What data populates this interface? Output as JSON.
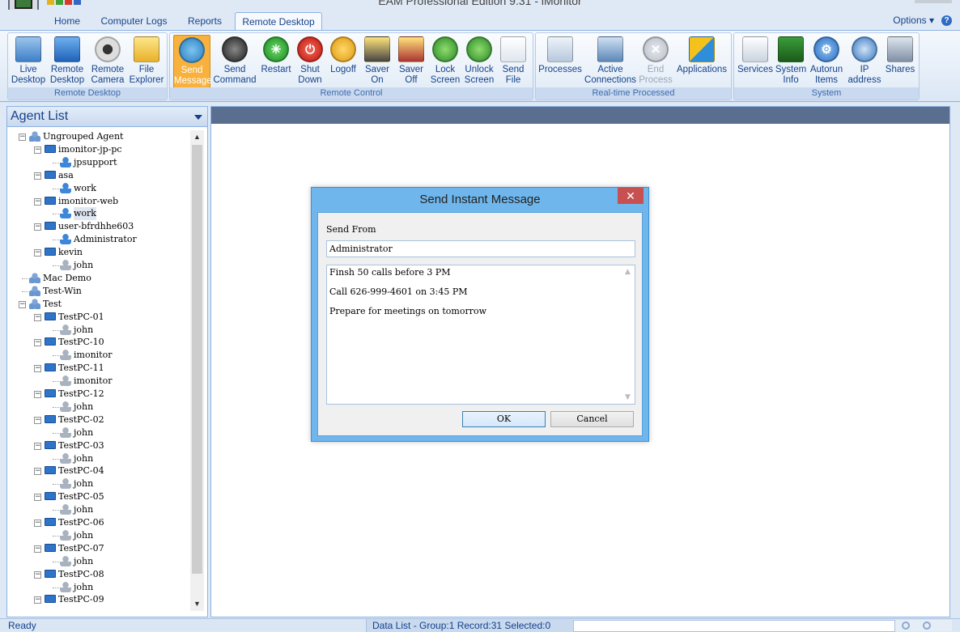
{
  "window": {
    "title": "EAM Professional Edition 9.31 - iMonitor"
  },
  "tabs": [
    {
      "label": "Home"
    },
    {
      "label": "Computer Logs"
    },
    {
      "label": "Reports"
    },
    {
      "label": "Remote Desktop",
      "active": true
    }
  ],
  "options_label": "Options",
  "ribbon": {
    "groups": [
      {
        "label": "Remote Desktop",
        "buttons": [
          {
            "label": "Live Desktop",
            "icon": "monitor-icon"
          },
          {
            "label": "Remote Desktop",
            "icon": "desktop-icon"
          },
          {
            "label": "Remote Camera",
            "icon": "webcam-icon"
          },
          {
            "label": "File Explorer",
            "icon": "folder-icon"
          }
        ]
      },
      {
        "label": "Remote Control",
        "buttons": [
          {
            "label": "Send Message",
            "icon": "message-icon",
            "active": true
          },
          {
            "label": "Send Command",
            "icon": "command-icon"
          },
          {
            "label": "Restart",
            "icon": "restart-icon"
          },
          {
            "label": "Shut Down",
            "icon": "power-icon"
          },
          {
            "label": "Logoff",
            "icon": "key-icon"
          },
          {
            "label": "Saver On",
            "icon": "screensaver-on-icon"
          },
          {
            "label": "Saver Off",
            "icon": "screensaver-off-icon"
          },
          {
            "label": "Lock Screen",
            "icon": "lock-screen-icon"
          },
          {
            "label": "Unlock Screen",
            "icon": "unlock-screen-icon"
          },
          {
            "label": "Send File",
            "icon": "send-file-icon"
          }
        ]
      },
      {
        "label": "Real-time Processed",
        "buttons": [
          {
            "label": "Processes",
            "icon": "processes-icon"
          },
          {
            "label": "Active Connections",
            "icon": "connections-icon"
          },
          {
            "label": "End Process",
            "icon": "end-process-icon",
            "disabled": true
          },
          {
            "label": "Applications",
            "icon": "applications-icon"
          }
        ]
      },
      {
        "label": "System",
        "buttons": [
          {
            "label": "Services",
            "icon": "services-icon"
          },
          {
            "label": "System Info",
            "icon": "system-info-icon"
          },
          {
            "label": "Autorun Items",
            "icon": "gear-icon"
          },
          {
            "label": "IP address",
            "icon": "ip-address-icon"
          },
          {
            "label": "Shares",
            "icon": "shares-icon"
          }
        ]
      }
    ]
  },
  "agent_panel": {
    "title": "Agent List",
    "tree": [
      {
        "label": "Ungrouped Agent",
        "level": 0,
        "type": "group"
      },
      {
        "label": "imonitor-jp-pc",
        "level": 1,
        "type": "pc"
      },
      {
        "label": "jpsupport",
        "level": 2,
        "type": "user",
        "online": true
      },
      {
        "label": "asa",
        "level": 1,
        "type": "pc"
      },
      {
        "label": "work",
        "level": 2,
        "type": "user",
        "online": true
      },
      {
        "label": "imonitor-web",
        "level": 1,
        "type": "pc"
      },
      {
        "label": "work",
        "level": 2,
        "type": "user",
        "online": true,
        "selected": true
      },
      {
        "label": "user-bfrdhhe603",
        "level": 1,
        "type": "pc"
      },
      {
        "label": "Administrator",
        "level": 2,
        "type": "user",
        "online": true
      },
      {
        "label": "kevin",
        "level": 1,
        "type": "pc"
      },
      {
        "label": "john",
        "level": 2,
        "type": "user",
        "online": false
      },
      {
        "label": "Mac Demo",
        "level": 0,
        "type": "group"
      },
      {
        "label": "Test-Win",
        "level": 0,
        "type": "group"
      },
      {
        "label": "Test",
        "level": 0,
        "type": "group"
      },
      {
        "label": "TestPC-01",
        "level": 1,
        "type": "pc"
      },
      {
        "label": "john",
        "level": 2,
        "type": "user",
        "online": false
      },
      {
        "label": "TestPC-10",
        "level": 1,
        "type": "pc"
      },
      {
        "label": "imonitor",
        "level": 2,
        "type": "user",
        "online": false
      },
      {
        "label": "TestPC-11",
        "level": 1,
        "type": "pc"
      },
      {
        "label": "imonitor",
        "level": 2,
        "type": "user",
        "online": false
      },
      {
        "label": "TestPC-12",
        "level": 1,
        "type": "pc"
      },
      {
        "label": "john",
        "level": 2,
        "type": "user",
        "online": false
      },
      {
        "label": "TestPC-02",
        "level": 1,
        "type": "pc"
      },
      {
        "label": "john",
        "level": 2,
        "type": "user",
        "online": false
      },
      {
        "label": "TestPC-03",
        "level": 1,
        "type": "pc"
      },
      {
        "label": "john",
        "level": 2,
        "type": "user",
        "online": false
      },
      {
        "label": "TestPC-04",
        "level": 1,
        "type": "pc"
      },
      {
        "label": "john",
        "level": 2,
        "type": "user",
        "online": false
      },
      {
        "label": "TestPC-05",
        "level": 1,
        "type": "pc"
      },
      {
        "label": "john",
        "level": 2,
        "type": "user",
        "online": false
      },
      {
        "label": "TestPC-06",
        "level": 1,
        "type": "pc"
      },
      {
        "label": "john",
        "level": 2,
        "type": "user",
        "online": false
      },
      {
        "label": "TestPC-07",
        "level": 1,
        "type": "pc"
      },
      {
        "label": "john",
        "level": 2,
        "type": "user",
        "online": false
      },
      {
        "label": "TestPC-08",
        "level": 1,
        "type": "pc"
      },
      {
        "label": "john",
        "level": 2,
        "type": "user",
        "online": false
      },
      {
        "label": "TestPC-09",
        "level": 1,
        "type": "pc"
      }
    ]
  },
  "dialog": {
    "title": "Send Instant Message",
    "send_from_label": "Send From",
    "send_from_value": "Administrator",
    "message_lines": [
      "Finsh 50 calls before 3 PM",
      "Call 626-999-4601 on 3:45 PM",
      "Prepare for meetings on tomorrow"
    ],
    "ok_label": "OK",
    "cancel_label": "Cancel"
  },
  "status": {
    "ready": "Ready",
    "data_list": "Data List - Group:1  Record:31  Selected:0"
  },
  "colors": {
    "accent": "#8db2e3",
    "active_button": "#f8b13d",
    "dialog_frame": "#6fb6ec",
    "close_button": "#c75050"
  }
}
